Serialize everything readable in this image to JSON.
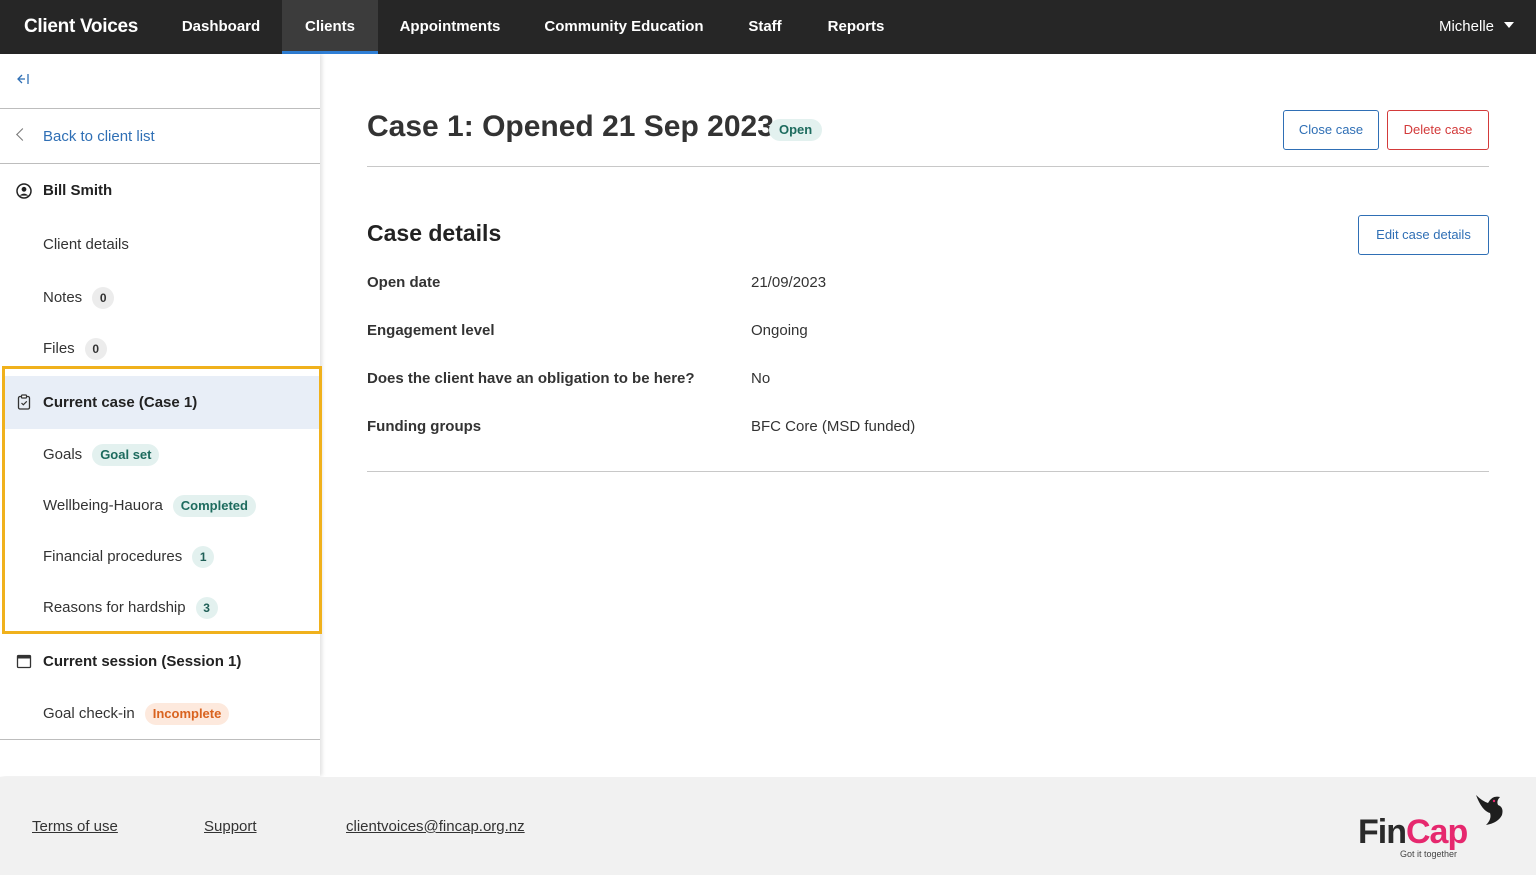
{
  "app": {
    "title": "Client Voices"
  },
  "nav": {
    "items": [
      {
        "label": "Dashboard"
      },
      {
        "label": "Clients"
      },
      {
        "label": "Appointments"
      },
      {
        "label": "Community Education"
      },
      {
        "label": "Staff"
      },
      {
        "label": "Reports"
      }
    ],
    "active": "Clients",
    "user": "Michelle"
  },
  "sidebar": {
    "collapse_icon": "collapse-left-icon",
    "back_label": "Back to client list",
    "client_name": "Bill Smith",
    "client_items": [
      {
        "label": "Client details"
      },
      {
        "label": "Notes",
        "count": "0"
      },
      {
        "label": "Files",
        "count": "0"
      }
    ],
    "current_case": {
      "label": "Current case (Case 1)",
      "items": [
        {
          "label": "Goals",
          "badge": "Goal set"
        },
        {
          "label": "Wellbeing-Hauora",
          "badge": "Completed"
        },
        {
          "label": "Financial procedures",
          "count": "1"
        },
        {
          "label": "Reasons for hardship",
          "count": "3"
        }
      ]
    },
    "current_session": {
      "label": "Current session (Session 1)",
      "items": [
        {
          "label": "Goal check-in",
          "badge": "Incomplete"
        }
      ]
    }
  },
  "main": {
    "case_title": "Case 1: Opened 21 Sep 2023",
    "case_status": "Open",
    "close_button": "Close case",
    "delete_button": "Delete case",
    "section_title": "Case details",
    "edit_button": "Edit case details",
    "details": [
      {
        "label": "Open date",
        "value": "21/09/2023"
      },
      {
        "label": "Engagement level",
        "value": "Ongoing"
      },
      {
        "label": "Does the client have an obligation to be here?",
        "value": "No"
      },
      {
        "label": "Funding groups",
        "value": "BFC Core (MSD funded)"
      }
    ]
  },
  "footer": {
    "links": [
      {
        "label": "Terms of use"
      },
      {
        "label": "Support"
      },
      {
        "label": "clientvoices@fincap.org.nz"
      }
    ],
    "logo": {
      "fin": "Fin",
      "cap": "Cap",
      "tagline": "Got it together"
    }
  },
  "colors": {
    "nav_bg": "#262626",
    "accent_blue": "#2f6fb5",
    "danger_red": "#d33a3a",
    "highlight": "#f0b11c",
    "badge_teal_bg": "#e3f1ef",
    "badge_orange": "#d9631f",
    "brand_pink": "#e6286e"
  }
}
